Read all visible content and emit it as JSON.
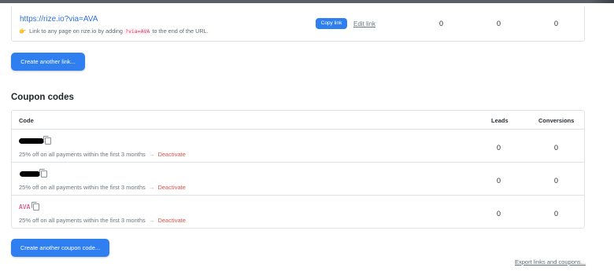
{
  "link_row": {
    "url": "https://rize.io?via=AVA",
    "hint_icon": "hand-pointing-icon",
    "hint_prefix": "Link to any page on rize.io by adding",
    "hint_token": "?via=AVA",
    "hint_suffix": "to the end of the URL.",
    "copy_label": "Copy link",
    "edit_label": "Edit link",
    "stats": [
      "0",
      "0",
      "0"
    ]
  },
  "create_link_button": "Create another link...",
  "coupons": {
    "title": "Coupon codes",
    "headers": {
      "code": "Code",
      "leads": "Leads",
      "conversions": "Conversions"
    },
    "rows": [
      {
        "code": "",
        "redacted": true,
        "description": "25% off on all payments within the first 3 months",
        "arrow": "→",
        "action": "Deactivate",
        "leads": "0",
        "conversions": "0"
      },
      {
        "code": "",
        "redacted": true,
        "description": "25% off on all payments within the first 3 months",
        "arrow": "→",
        "action": "Deactivate",
        "leads": "0",
        "conversions": "0"
      },
      {
        "code": "AVA",
        "redacted": false,
        "description": "25% off on all payments within the first 3 months",
        "arrow": "→",
        "action": "Deactivate",
        "leads": "0",
        "conversions": "0"
      }
    ]
  },
  "create_coupon_button": "Create another coupon code...",
  "export_link": "Export links and coupons...",
  "colors": {
    "accent": "#2f7ff0",
    "danger": "#e0524a",
    "code": "#d63864"
  }
}
